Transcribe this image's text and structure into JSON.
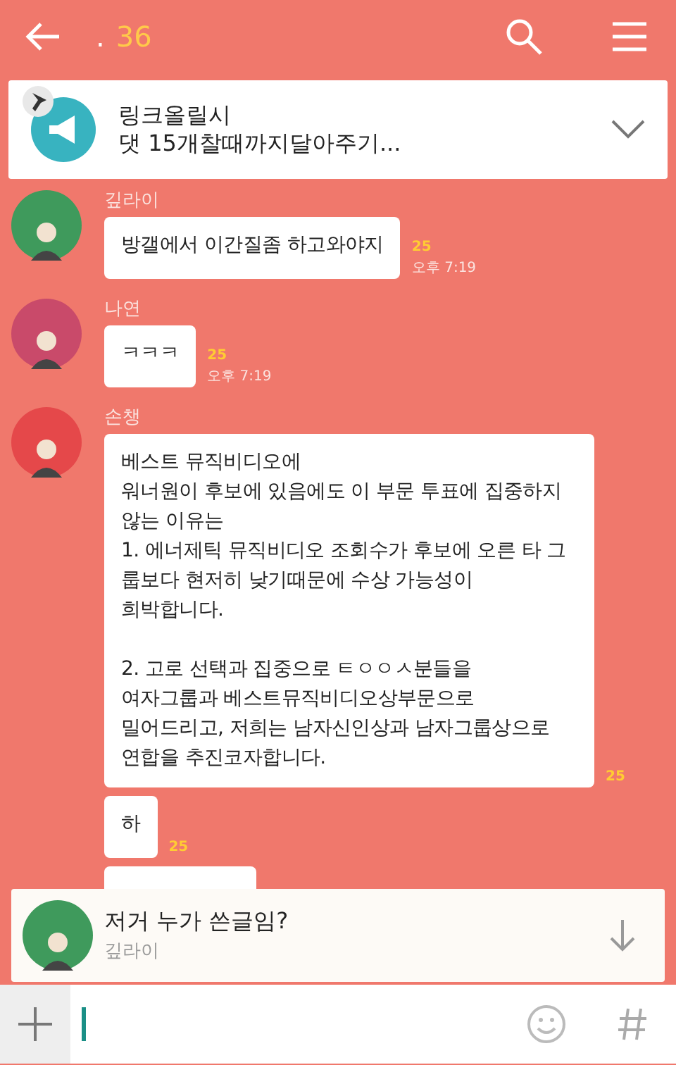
{
  "header": {
    "title": ".",
    "member_count": "36"
  },
  "notice": {
    "title": "링크올릴시",
    "text": "댓 15개찰때까지달아주기...",
    "pinned": true
  },
  "groups": [
    {
      "sender": "깊라이",
      "color": "#3f9a5c",
      "messages": [
        {
          "text": "방갤에서 이간질좀 하고와야지",
          "unread": "25",
          "time": "오후 7:19"
        }
      ]
    },
    {
      "sender": "나연",
      "color": "#c94a6a",
      "messages": [
        {
          "text": "ㅋㅋㅋ",
          "unread": "25",
          "time": "오후 7:19"
        }
      ]
    },
    {
      "sender": "손챙",
      "color": "#e5484a",
      "messages": [
        {
          "text": "베스트 뮤직비디오에\n워너원이 후보에 있음에도 이 부문 투표에 집중하지 않는 이유는\n1. 에너제틱 뮤직비디오 조회수가 후보에 오른 타 그룹보다 현저히 낮기때문에 수상 가능성이\n희박합니다.\n\n2. 고로 선택과 집중으로 ㅌㅇㅇㅅ분들을\n여자그룹과 베스트뮤직비디오상부문으로\n밀어드리고, 저희는 남자신인상과 남자그룹상으로\n연합을 추진코자합니다.",
          "unread": "25"
        },
        {
          "text": "하",
          "unread": "25"
        },
        {
          "kind": "cut"
        }
      ]
    }
  ],
  "preview": {
    "text": "저거 누가 쓴글임?",
    "sender": "깊라이",
    "color": "#3f9a5c"
  }
}
